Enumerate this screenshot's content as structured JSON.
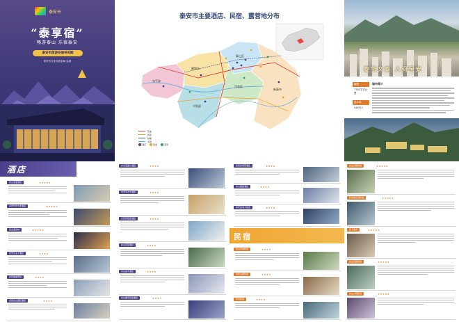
{
  "cover": {
    "logo_text": "泰安市",
    "main_title": "“泰享宿”",
    "subtitle": "畅游泰山 乐宿泰安",
    "pill_text": "泰安市旅游住宿导览图",
    "issuer": "泰安市文化和旅游局 监制"
  },
  "map": {
    "title": "泰安市主要酒店、民宿、露营地分布",
    "inset_label": "山东省地图",
    "districts": [
      "东平县",
      "宁阳县",
      "岱岳区",
      "泰山区",
      "新泰市",
      "肥城市"
    ],
    "legend_lines": [
      {
        "label": "高速",
        "color": "#e8463a"
      },
      {
        "label": "国道",
        "color": "#f0a531"
      },
      {
        "label": "铁路",
        "color": "#3a4f7a"
      },
      {
        "label": "河流",
        "color": "#5aa7e0"
      }
    ],
    "legend_points": [
      {
        "label": "酒店",
        "color": "#4b3f8a"
      },
      {
        "label": "民宿",
        "color": "#f0a531"
      },
      {
        "label": "露营",
        "color": "#2fa36b"
      }
    ]
  },
  "city": {
    "slogan": "泰华文泰 人间留安",
    "stats": [
      {
        "label": "面积",
        "value": "7762平方公里"
      },
      {
        "label": "总人口",
        "value": "546万人"
      }
    ],
    "intro_title": "城市简介"
  },
  "hotels": {
    "section_label": "酒店",
    "left_items": [
      {
        "name": "泰山宝盛酒店",
        "stars": "★★★★★"
      },
      {
        "name": "泰安华侨大厦酒店",
        "stars": "★★★★★"
      },
      {
        "name": "泰山温泉城",
        "stars": "★★★★★"
      },
      {
        "name": "泰安东岳大酒店",
        "stars": "★★★★"
      },
      {
        "name": "泰安御座宾馆",
        "stars": "★★★★"
      },
      {
        "name": "泰安泰山国际酒店",
        "stars": "★★★★"
      }
    ],
    "mid_items": [
      {
        "name": "泰山宝盛大酒店",
        "stars": "★★★★"
      },
      {
        "name": "泰安东方大酒店",
        "stars": "★★★★"
      },
      {
        "name": "泰安碧桂园酒店",
        "stars": "★★★★"
      },
      {
        "name": "泰山花园酒店",
        "stars": "★★★★"
      },
      {
        "name": "泰山晨光酒店",
        "stars": "★★★★"
      },
      {
        "name": "泰山福景花园酒店",
        "stars": "★★★★"
      }
    ],
    "third_items": [
      {
        "name": "泰安喜来登酒店",
        "stars": "★★★★"
      },
      {
        "name": "泰山银座酒店",
        "stars": "★★★★"
      },
      {
        "name": "泰安蓝海大饭店",
        "stars": "★★★★"
      }
    ]
  },
  "minsu": {
    "section_label": "民宿",
    "items": [
      {
        "name": "泰山竹林民宿",
        "stars": "★★★★"
      },
      {
        "name": "泰安山居民宿",
        "stars": "★★★★"
      },
      {
        "name": "花间民宿",
        "stars": "★★★★"
      }
    ],
    "right_items": [
      {
        "name": "泰山云栖民宿",
        "stars": "★★★★★"
      },
      {
        "name": "泰安桃花源民宿",
        "stars": "★★★★★"
      },
      {
        "name": "岱下民宿",
        "stars": "★★★★★"
      },
      {
        "name": "泰山归园民宿",
        "stars": "★★★★★"
      },
      {
        "name": "泰山小院民宿",
        "stars": "★★★★★"
      }
    ]
  }
}
